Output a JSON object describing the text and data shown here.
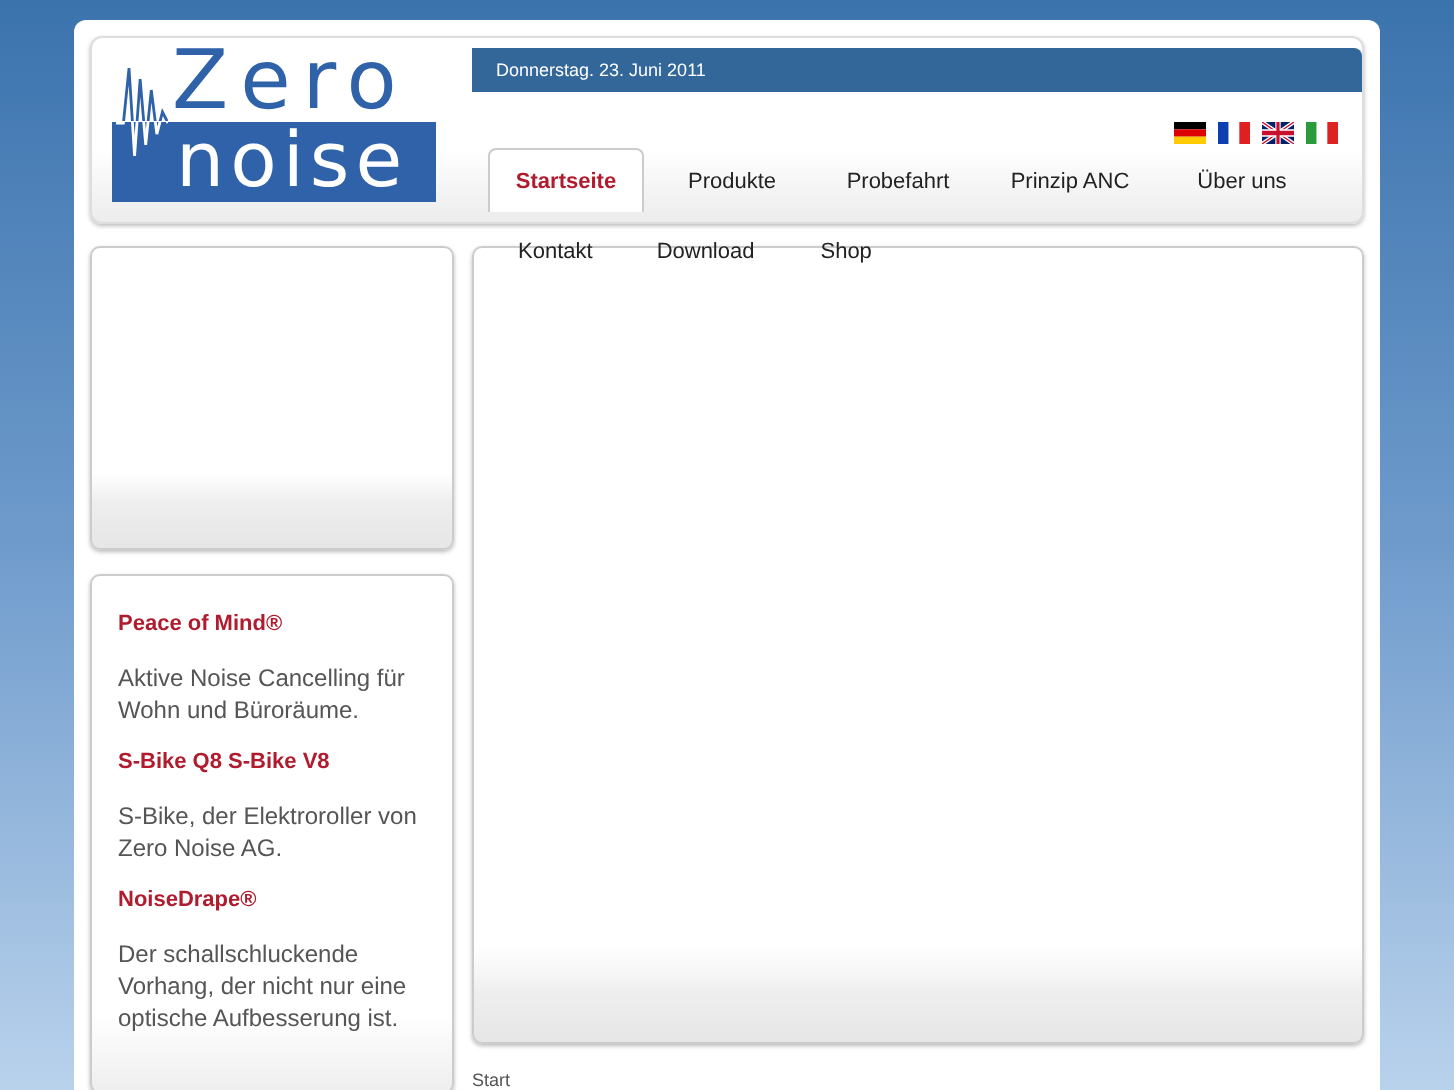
{
  "logo": {
    "top": "Zero",
    "bottom": "noise"
  },
  "date": "Donnerstag. 23. Juni 2011",
  "tabs": [
    {
      "label": "Startseite",
      "selected": true
    },
    {
      "label": "Produkte",
      "selected": false
    },
    {
      "label": "Probefahrt",
      "selected": false
    },
    {
      "label": "Prinzip ANC",
      "selected": false
    },
    {
      "label": "Über uns",
      "selected": false
    }
  ],
  "links": [
    "Kontakt",
    "Download",
    "Shop"
  ],
  "news": [
    {
      "title": "Peace of Mind®",
      "text": "Aktive Noise Cancelling für Wohn und Büroräume."
    },
    {
      "title": "S-Bike Q8 S-Bike V8",
      "text": "S-Bike, der Elektroroller von Zero Noise AG."
    },
    {
      "title": "NoiseDrape®",
      "text": "Der schallschluckende Vorhang, der nicht nur eine optische Aufbesserung ist."
    }
  ],
  "breadcrumb": "Start"
}
